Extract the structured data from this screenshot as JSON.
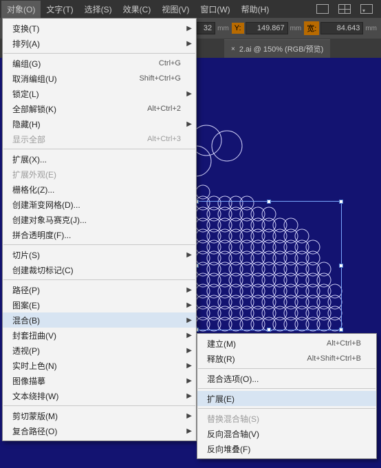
{
  "menubar": {
    "items": [
      "对象(O)",
      "文字(T)",
      "选择(S)",
      "效果(C)",
      "视图(V)",
      "窗口(W)",
      "帮助(H)"
    ]
  },
  "toolbar": {
    "x_value": "32",
    "y_label": "Y:",
    "y_value": "149.867",
    "w_label": "宽:",
    "w_value": "84.643",
    "unit": "mm"
  },
  "tab": {
    "title": "2.ai @ 150% (RGB/预览)"
  },
  "menu1": {
    "g1": [
      {
        "label": "变换(T)",
        "sub": true
      },
      {
        "label": "排列(A)",
        "sub": true
      }
    ],
    "g2": [
      {
        "label": "编组(G)",
        "shortcut": "Ctrl+G"
      },
      {
        "label": "取消编组(U)",
        "shortcut": "Shift+Ctrl+G"
      },
      {
        "label": "锁定(L)",
        "sub": true
      },
      {
        "label": "全部解锁(K)",
        "shortcut": "Alt+Ctrl+2"
      },
      {
        "label": "隐藏(H)",
        "sub": true
      },
      {
        "label": "显示全部",
        "shortcut": "Alt+Ctrl+3",
        "disabled": true
      }
    ],
    "g3": [
      {
        "label": "扩展(X)..."
      },
      {
        "label": "扩展外观(E)",
        "disabled": true
      },
      {
        "label": "栅格化(Z)..."
      },
      {
        "label": "创建渐变网格(D)..."
      },
      {
        "label": "创建对象马赛克(J)..."
      },
      {
        "label": "拼合透明度(F)..."
      }
    ],
    "g4": [
      {
        "label": "切片(S)",
        "sub": true
      },
      {
        "label": "创建裁切标记(C)"
      }
    ],
    "g5": [
      {
        "label": "路径(P)",
        "sub": true
      },
      {
        "label": "图案(E)",
        "sub": true
      },
      {
        "label": "混合(B)",
        "sub": true,
        "highlight": true
      },
      {
        "label": "封套扭曲(V)",
        "sub": true
      },
      {
        "label": "透视(P)",
        "sub": true
      },
      {
        "label": "实时上色(N)",
        "sub": true
      },
      {
        "label": "图像描摹",
        "sub": true
      },
      {
        "label": "文本绕排(W)",
        "sub": true
      }
    ],
    "g6": [
      {
        "label": "剪切蒙版(M)",
        "sub": true
      },
      {
        "label": "复合路径(O)",
        "sub": true
      }
    ]
  },
  "menu2": {
    "g1": [
      {
        "label": "建立(M)",
        "shortcut": "Alt+Ctrl+B"
      },
      {
        "label": "释放(R)",
        "shortcut": "Alt+Shift+Ctrl+B"
      }
    ],
    "g2": [
      {
        "label": "混合选项(O)..."
      }
    ],
    "g3": [
      {
        "label": "扩展(E)",
        "highlight": true
      }
    ],
    "g4": [
      {
        "label": "替换混合轴(S)",
        "disabled": true
      },
      {
        "label": "反向混合轴(V)"
      },
      {
        "label": "反向堆叠(F)"
      }
    ]
  }
}
